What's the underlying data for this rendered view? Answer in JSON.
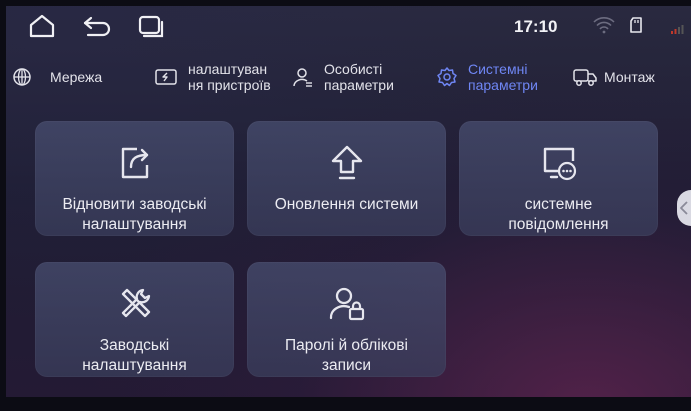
{
  "status_bar": {
    "time": "17:10",
    "icons": [
      "home-icon",
      "back-icon",
      "recent-apps-icon",
      "wifi-icon",
      "sd-card-icon",
      "signal-icon"
    ]
  },
  "tabs": [
    {
      "label": "Мережа",
      "icon": "globe-icon",
      "active": false
    },
    {
      "label": "налаштуван\nня пристроїв",
      "icon": "device-settings-icon",
      "active": false
    },
    {
      "label": "Особисті\nпараметри",
      "icon": "user-icon",
      "active": false
    },
    {
      "label": "Системні\nпараметри",
      "icon": "gear-icon",
      "active": true
    },
    {
      "label": "Монтаж",
      "icon": "truck-icon",
      "active": false
    }
  ],
  "cards": [
    {
      "label": "Відновити заводські\nналаштування",
      "icon": "restore-icon"
    },
    {
      "label": "Оновлення системи",
      "icon": "upload-arrow-icon"
    },
    {
      "label": "системне\nповідомлення",
      "icon": "message-icon"
    },
    {
      "label": "Заводські\nналаштування",
      "icon": "tools-icon"
    },
    {
      "label": "Паролі й облікові\nзаписи",
      "icon": "user-lock-icon"
    }
  ],
  "colors": {
    "accent": "#6f86f4",
    "card": "#454a6a",
    "background": "#1e1d33"
  }
}
